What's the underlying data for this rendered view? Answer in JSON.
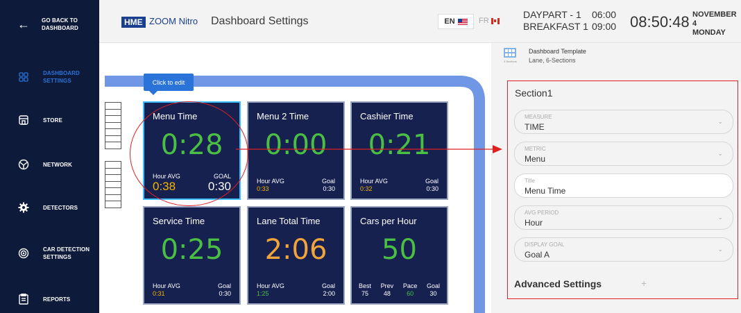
{
  "sidebar": {
    "back_label_line1": "GO BACK TO",
    "back_label_line2": "DASHBOARD",
    "items": [
      {
        "line1": "DASHBOARD",
        "line2": "SETTINGS",
        "icon": "dashboard-grid-icon"
      },
      {
        "line1": "STORE",
        "line2": "",
        "icon": "store-icon"
      },
      {
        "line1": "NETWORK",
        "line2": "",
        "icon": "network-icon"
      },
      {
        "line1": "DETECTORS",
        "line2": "",
        "icon": "gear-icon"
      },
      {
        "line1": "CAR DETECTION",
        "line2": "SETTINGS",
        "icon": "car-detection-icon"
      },
      {
        "line1": "REPORTS",
        "line2": "",
        "icon": "clipboard-icon"
      }
    ]
  },
  "header": {
    "logo": "HME",
    "product": "ZOOM Nitro",
    "title": "Dashboard Settings",
    "lang_en": "EN",
    "lang_fr": "FR",
    "daypart_line1": "DAYPART - 1",
    "daypart_line2": "BREAKFAST 1",
    "time_start": "06:00",
    "time_end": "09:00",
    "clock": "08:50:48",
    "date_line1": "NOVEMBER 4",
    "date_line2": "MONDAY"
  },
  "canvas": {
    "click_to_edit": "Click to edit",
    "tiles": [
      {
        "title": "Menu Time",
        "value": "0:28",
        "value_color": "green",
        "foot_left_label": "Hour AVG",
        "foot_left_value": "0:38",
        "foot_left_color": "yellow",
        "foot_right_label": "GOAL",
        "foot_right_value": "0:30",
        "big_foot": true
      },
      {
        "title": "Menu 2 Time",
        "value": "0:00",
        "value_color": "green",
        "foot_left_label": "Hour AVG",
        "foot_left_value": "0:33",
        "foot_left_color": "yellow",
        "foot_right_label": "Goal",
        "foot_right_value": "0:30",
        "big_foot": false
      },
      {
        "title": "Cashier Time",
        "value": "0:21",
        "value_color": "green",
        "foot_left_label": "Hour AVG",
        "foot_left_value": "0:32",
        "foot_left_color": "yellow",
        "foot_right_label": "Goal",
        "foot_right_value": "0:30",
        "big_foot": false
      },
      {
        "title": "Service Time",
        "value": "0:25",
        "value_color": "green",
        "foot_left_label": "Hour AVG",
        "foot_left_value": "0:31",
        "foot_left_color": "yellow",
        "foot_right_label": "Goal",
        "foot_right_value": "0:30",
        "big_foot": false
      },
      {
        "title": "Lane Total Time",
        "value": "2:06",
        "value_color": "orange",
        "foot_left_label": "Hour AVG",
        "foot_left_value": "1:25",
        "foot_left_color": "green",
        "foot_right_label": "Goal",
        "foot_right_value": "2:00",
        "big_foot": false
      }
    ],
    "cars_tile": {
      "title": "Cars per Hour",
      "value": "50",
      "stats": [
        {
          "label": "Best",
          "value": "75",
          "color": "white"
        },
        {
          "label": "Prev",
          "value": "48",
          "color": "white"
        },
        {
          "label": "Pace",
          "value": "60",
          "color": "green"
        },
        {
          "label": "Goal",
          "value": "30",
          "color": "white"
        }
      ]
    }
  },
  "panel": {
    "template_icon_caption": "3 Sections",
    "template_title": "Dashboard Template",
    "template_desc": "Lane, 6-Sections",
    "section_title": "Section1",
    "fields": [
      {
        "label": "MEASURE",
        "value": "TIME",
        "dropdown": true
      },
      {
        "label": "METRIC",
        "value": "Menu",
        "dropdown": true
      },
      {
        "label": "Title",
        "value": "Menu Time",
        "dropdown": false
      },
      {
        "label": "AVG PERIOD",
        "value": "Hour",
        "dropdown": true
      },
      {
        "label": "DISPLAY GOAL",
        "value": "Goal A",
        "dropdown": true
      }
    ],
    "advanced_label": "Advanced Settings",
    "advanced_plus": "+"
  },
  "colors": {
    "sidebar_bg": "#0d1a3a",
    "tile_bg": "#172150",
    "accent_blue": "#2a73d8",
    "value_green": "#4bbf44",
    "value_yellow": "#f4b400",
    "value_orange": "#f0a43a",
    "annotation_red": "#e02020"
  }
}
